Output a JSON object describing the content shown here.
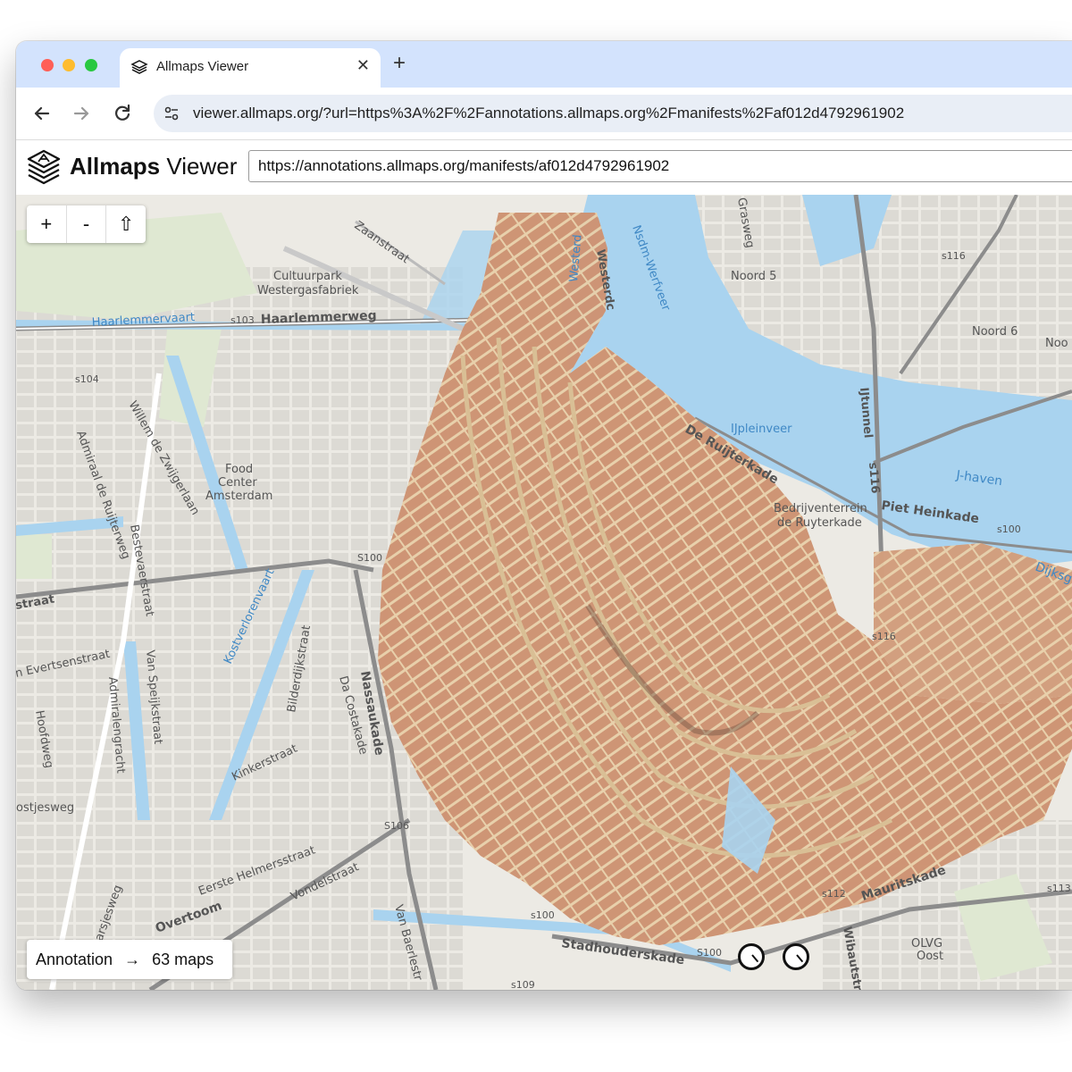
{
  "browser": {
    "tab_title": "Allmaps Viewer",
    "tab_close": "✕",
    "new_tab": "+",
    "address": "viewer.allmaps.org/?url=https%3A%2F%2Fannotations.allmaps.org%2Fmanifests%2Faf012d4792961902"
  },
  "app": {
    "name_bold": "Allmaps",
    "name_light": " Viewer",
    "manifest_url": "https://annotations.allmaps.org/manifests/af012d4792961902"
  },
  "map_controls": {
    "zoom_in": "+",
    "zoom_out": "-",
    "home": "⇧"
  },
  "status": {
    "label": "Annotation",
    "arrow": "→",
    "count": "63 maps"
  },
  "map_labels": {
    "zaanstraat": "Zaanstraat",
    "cultuurpark1": "Cultuurpark",
    "cultuurpark2": "Westergasfabriek",
    "haarlemmervaart": "Haarlemmervaart",
    "haarlemmerweg": "Haarlemmerweg",
    "s103": "s103",
    "s104": "s104",
    "westerdok": "Westerdc",
    "westerd": "Westerd",
    "nsdm": "Nsdm-Werfveer",
    "grasweg": "Grasweg",
    "noord5": "Noord 5",
    "noord6": "Noord 6",
    "noo": "Noo",
    "s116a": "s116",
    "ijpleinveer": "IJpleinveer",
    "ijtunnel": "IJtunnel",
    "s116b": "s116",
    "jhaven": "J-haven",
    "deruijterkade": "De Ruijterkade",
    "bedrijf1": "Bedrijventerrein",
    "bedrijf2": "de Ruyterkade",
    "pietheinkade": "Piet Heinkade",
    "s100a": "s100",
    "dijksg": "Dijksg",
    "willem": "Willem de Zwijgerlaan",
    "admiraal": "Admiraal de Ruijterweg",
    "food1": "Food",
    "food2": "Center",
    "food3": "Amsterdam",
    "s100b": "S100",
    "bestevaer": "Bestevaerstraat",
    "straat": "straat",
    "evertsen": "n Evertsenstraat",
    "speijk": "Van Speijkstraat",
    "admiralen": "Admiralengracht",
    "hoofdweg": "Hoofdweg",
    "kostverloren": "Kostverlorenvaart",
    "bilderdijk": "Bilderdijkstraat",
    "dacosta": "Da Costakade",
    "nassaukade": "Nassaukade",
    "kinker": "Kinkerstraat",
    "postjes": "ostjesweg",
    "s106": "S106",
    "helmers": "Eerste Helmersstraat",
    "vondel": "Vondelstraat",
    "overtoom": "Overtoom",
    "baerle": "Van Baerlestr",
    "arsjesweg": "arsjesweg",
    "s100c": "s100",
    "s100d": "S100",
    "stadhouders": "Stadhouderskade",
    "s109": "s109",
    "s112": "s112",
    "mauritskade": "Mauritskade",
    "wibaut": "Wibautstr",
    "olvg1": "OLVG",
    "olvg2": "Oost",
    "s113": "s113",
    "s116c": "s116"
  }
}
